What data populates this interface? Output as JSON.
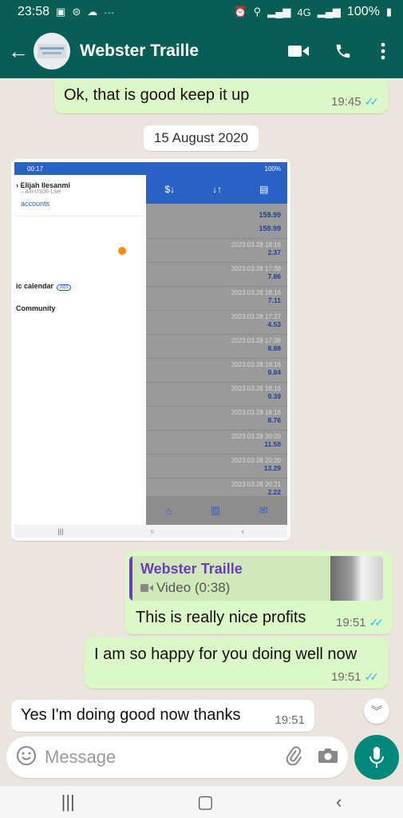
{
  "status_bar": {
    "time": "23:58",
    "dots": "···",
    "signal": "4G",
    "battery": "100%"
  },
  "header": {
    "contact_name": "Webster Traille"
  },
  "messages": [
    {
      "text": "Ok, that is good keep it up",
      "time": "19:45"
    }
  ],
  "date_divider": "15 August 2020",
  "screenshot": {
    "status_time": "00:17",
    "status_right": "100%",
    "user_name": "Elijah Ilesanmi",
    "account": "Axi-US06-Live",
    "link": "accounts",
    "badge": "5",
    "menu_calendar": "ic calendar",
    "menu_calendar_pill": "Ads",
    "menu_community": "Community",
    "top_values": [
      "159.99",
      "159.99"
    ],
    "rows": [
      {
        "date": "2023.03.28 18:16",
        "value": "2.37"
      },
      {
        "date": "2023.03.28 17:38",
        "value": "7.86"
      },
      {
        "date": "2023.03.28 18:16",
        "value": "7.11"
      },
      {
        "date": "2023.03.28 17:27",
        "value": "4.53"
      },
      {
        "date": "2023.03.28 17:38",
        "value": "8.88"
      },
      {
        "date": "2023.03.28 18:16",
        "value": "9.84"
      },
      {
        "date": "2023.03.28 18:16",
        "value": "9.39"
      },
      {
        "date": "2023.03.28 18:16",
        "value": "8.76"
      },
      {
        "date": "2023.03.28 20:20",
        "value": "11.58"
      },
      {
        "date": "2023.03.28 20:20",
        "value": "13.29"
      },
      {
        "date": "2023.03.28 20:21",
        "value": "2.22"
      }
    ]
  },
  "reply": {
    "quoted_name": "Webster Traille",
    "quoted_subtitle": "Video (0:38)",
    "text": "This is really nice profits",
    "time": "19:51"
  },
  "message_happy": {
    "text": "I am so happy for you doing well now",
    "time": "19:51"
  },
  "message_incoming": {
    "text": "Yes I'm doing good now thanks",
    "time": "19:51"
  },
  "composer": {
    "placeholder": "Message"
  },
  "colors": {
    "header": "#075e54",
    "outgoing": "#dcf8c6",
    "incoming": "#ffffff",
    "background": "#ece5dd",
    "mic": "#00897b",
    "read_ticks": "#34b7f1"
  }
}
